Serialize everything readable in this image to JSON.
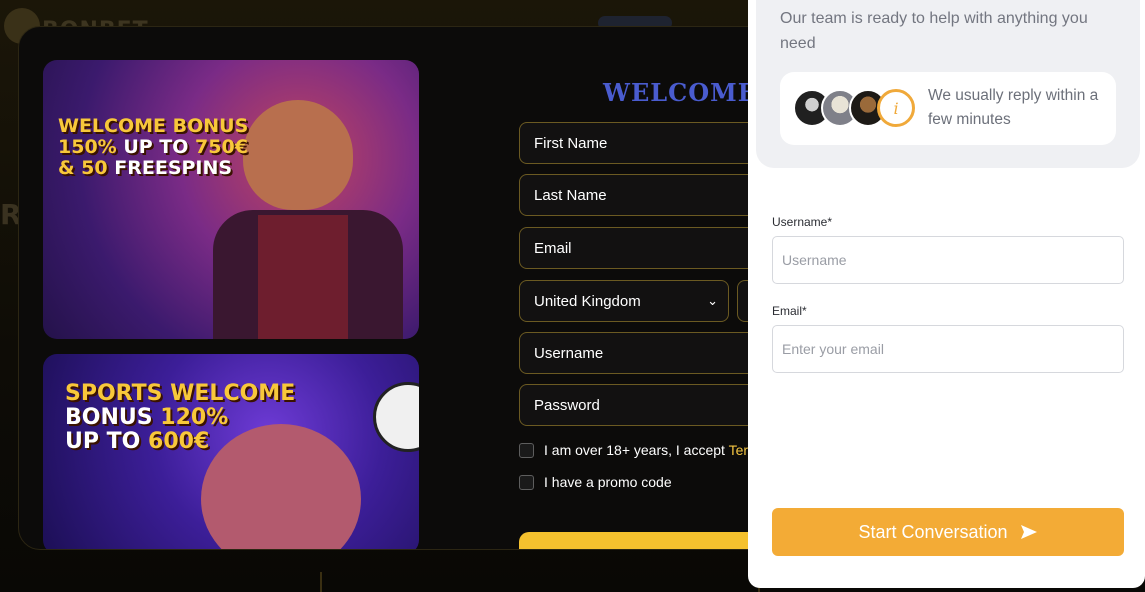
{
  "background": {
    "logo_text": "BONBET",
    "side_letter": "R"
  },
  "signup": {
    "heading": "WELCOME T",
    "promo1": {
      "line1": "WELCOME BONUS",
      "line2_a": "150%",
      "line2_b": "UP TO",
      "line2_c": "750€",
      "line3_a": "& 50",
      "line3_b": "FREESPINS"
    },
    "promo2": {
      "line1": "SPORTS WELCOME",
      "line2_a": "BONUS",
      "line2_b": "120%",
      "line3_a": "UP TO",
      "line3_b": "600€"
    },
    "fields": {
      "first_name": "First Name",
      "last_name": "Last Name",
      "email": "Email",
      "country": "United Kingdom",
      "username": "Username",
      "password": "Password"
    },
    "age_check_label": "I am over 18+ years, I accept",
    "terms_link": "Terr",
    "promo_check_label": "I have a promo code",
    "accent": "#f5c12e"
  },
  "chat": {
    "intro": "Our team is ready to help with anything you need",
    "reply_time": "We usually reply within a few minutes",
    "username_label": "Username*",
    "username_placeholder": "Username",
    "email_label": "Email*",
    "email_placeholder": "Enter your email",
    "start_button": "Start Conversation",
    "accent": "#f3ab36"
  }
}
